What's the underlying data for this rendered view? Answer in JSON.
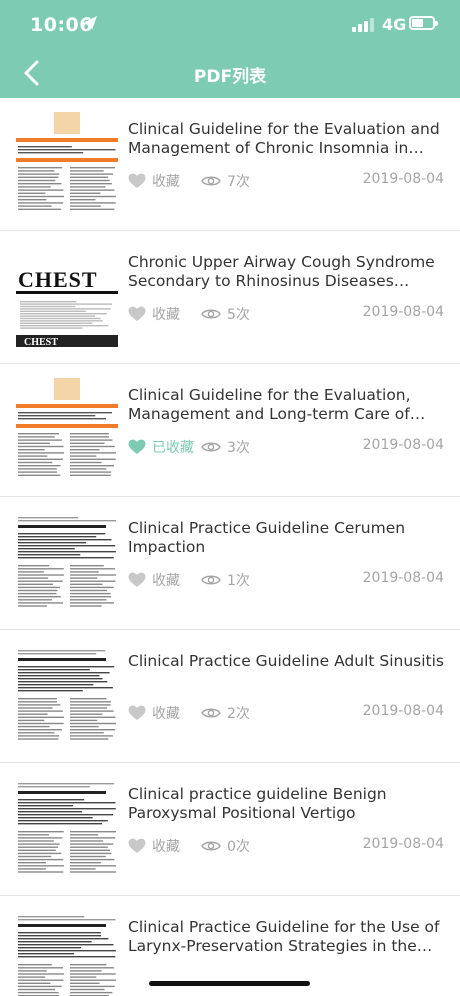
{
  "status": {
    "time": "10:06",
    "network": "4G"
  },
  "nav": {
    "title": "PDF列表"
  },
  "colors": {
    "accent": "#7ecbb4",
    "muted": "#a5a5a5"
  },
  "list": [
    {
      "title": "Clinical Guideline for the Evaluation and Management of Chronic Insomnia in Adults",
      "fav_label": "收藏",
      "favorited": false,
      "views": "7次",
      "date": "2019-08-04"
    },
    {
      "title": "Chronic Upper Airway Cough Syndrome Secondary to Rhinosinus Diseases (Previously Referred to as Postnasal Drip Syndrome)",
      "fav_label": "收藏",
      "favorited": false,
      "views": "5次",
      "date": "2019-08-04"
    },
    {
      "title": "Clinical Guideline for the Evaluation, Management and Long-term Care of Obstructive Sleep Apnea in Adults",
      "fav_label": "已收藏",
      "favorited": true,
      "views": "3次",
      "date": "2019-08-04"
    },
    {
      "title": "Clinical Practice Guideline  Cerumen Impaction",
      "fav_label": "收藏",
      "favorited": false,
      "views": "1次",
      "date": "2019-08-04"
    },
    {
      "title": "Clinical Practice Guideline Adult Sinusitis",
      "fav_label": "收藏",
      "favorited": false,
      "views": "2次",
      "date": "2019-08-04"
    },
    {
      "title": "Clinical practice guideline Benign Paroxysmal Positional Vertigo",
      "fav_label": "收藏",
      "favorited": false,
      "views": "0次",
      "date": "2019-08-04"
    },
    {
      "title": "Clinical Practice Guideline for the Use of Larynx-Preservation Strategies in the Treatment of Laryngeal Cancer",
      "fav_label": "",
      "favorited": false,
      "views": "",
      "date": ""
    }
  ],
  "thumbnails": [
    {
      "kind": "sleep",
      "header_text": "Clinical Guideline for the Evaluation and Management of Chronic Insomnia"
    },
    {
      "kind": "chest",
      "header_text": "CHEST"
    },
    {
      "kind": "sleep",
      "header_text": "Clinical Guideline for the Evaluation, Management and Long-term Care of Obstructive Sleep Apnea in Adults"
    },
    {
      "kind": "paper",
      "header_text": "Clinical practice guideline: Cerumen impaction"
    },
    {
      "kind": "paper",
      "header_text": "Clinical practice guideline: Adult sinusitis"
    },
    {
      "kind": "paper",
      "header_text": "Clinical practice guideline: Benign paroxysmal positional vertigo"
    },
    {
      "kind": "paper",
      "header_text": "American Society of Clinical Oncology Clinical Practice Guideline for the Use of Larynx-Preservation Strategies in the Treatment of Laryngeal Cancer"
    }
  ]
}
